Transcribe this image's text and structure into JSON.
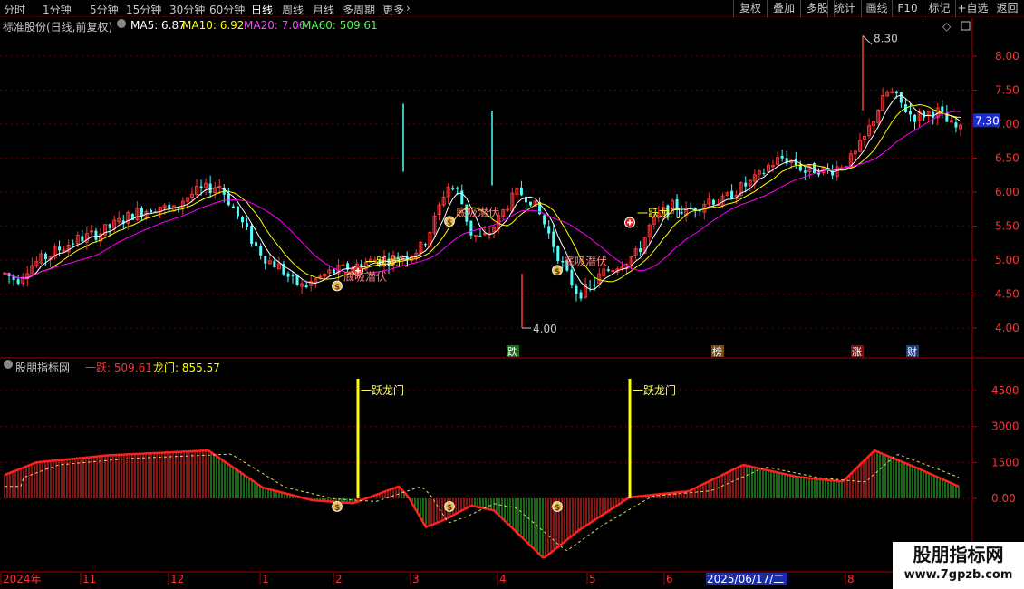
{
  "toolbar": {
    "periods": [
      "分时",
      "1分钟",
      "5分钟",
      "15分钟",
      "30分钟",
      "60分钟",
      "日线",
      "周线",
      "月线",
      "多周期",
      "更多"
    ],
    "more_arrow": "›",
    "active_period": "日线",
    "right_buttons": [
      "复权",
      "叠加",
      "多股",
      "统计",
      "画线",
      "F10",
      "标记",
      "+自选",
      "返回"
    ]
  },
  "main_panel": {
    "title": "标准股份(日线,前复权)",
    "ma5_label": "MA5: 6.87",
    "ma10_label": "MA10: 6.92",
    "ma20_label": "MA20: 7.06",
    "ma60_label": "MA60: 509.61",
    "price_axis": [
      "8.00",
      "7.50",
      "7.00",
      "6.50",
      "6.00",
      "5.50",
      "5.00",
      "4.50",
      "4.00"
    ],
    "current_price_tag": "7.30",
    "high_marker": "8.30",
    "low_marker": "4.00",
    "signals": [
      {
        "text": "一跃龙门"
      },
      {
        "text": "底吸潜伏"
      },
      {
        "text": "底吸潜伏"
      },
      {
        "text": "底吸潜伏"
      },
      {
        "text": "一跃龙门"
      }
    ],
    "event_tags": [
      "跌",
      "榜",
      "涨",
      "财"
    ],
    "colors": {
      "up": "#ff3232",
      "down": "#54fcfc",
      "ma5": "#ffffff",
      "ma10": "#ffff00",
      "ma20": "#ff00ff",
      "ma60": "#00ff00"
    }
  },
  "indicator_panel": {
    "title": "股朋指标网",
    "yiyue_label": "一跃: 509.61",
    "longmen_label": "龙门: 855.57",
    "axis": [
      "4500",
      "3000",
      "1500",
      "0.00"
    ],
    "signal_1": "一跃龙门",
    "signal_2": "一跃龙门"
  },
  "date_axis": {
    "labels": [
      "2024年",
      "11",
      "12",
      "1",
      "2",
      "3",
      "4",
      "5",
      "6",
      "2025/06/17/二",
      "8"
    ]
  },
  "watermark": {
    "line1": "股朋指标网",
    "line2": "www.7gpzb.com"
  },
  "chart_data": {
    "type": "candlestick",
    "price_range": [
      4.0,
      8.3
    ],
    "ma60_ylim": [
      4.0,
      8.3
    ],
    "indicator_range": [
      -2800,
      5500
    ],
    "indicator_ticks": [
      4500,
      3000,
      1500,
      0
    ],
    "x_labels": [
      "2024年",
      "11",
      "12",
      "1",
      "2",
      "3",
      "4",
      "5",
      "6",
      "2025/06/17/二",
      "8"
    ],
    "close_series": [
      4.8,
      4.7,
      4.9,
      5.0,
      5.1,
      5.2,
      5.3,
      5.35,
      5.4,
      5.5,
      5.6,
      5.7,
      5.75,
      5.8,
      5.7,
      5.9,
      6.0,
      6.05,
      6.1,
      5.8,
      5.5,
      5.2,
      5.0,
      4.9,
      4.7,
      4.6,
      4.7,
      4.8,
      4.85,
      4.9,
      4.95,
      5.0,
      5.0,
      5.05,
      5.1,
      5.2,
      5.6,
      6.1,
      6.0,
      5.4,
      5.3,
      5.5,
      5.8,
      6.0,
      5.9,
      5.6,
      5.2,
      4.8,
      4.5,
      4.6,
      4.8,
      4.9,
      5.0,
      5.1,
      5.5,
      5.7,
      5.8,
      5.7,
      5.8,
      5.9,
      5.85,
      6.0,
      6.1,
      6.2,
      6.4,
      6.5,
      6.45,
      6.3,
      6.35,
      6.3,
      6.4,
      6.5,
      6.8,
      7.2,
      7.5,
      7.3,
      7.1,
      7.15,
      7.2,
      7.0,
      6.9
    ]
  }
}
